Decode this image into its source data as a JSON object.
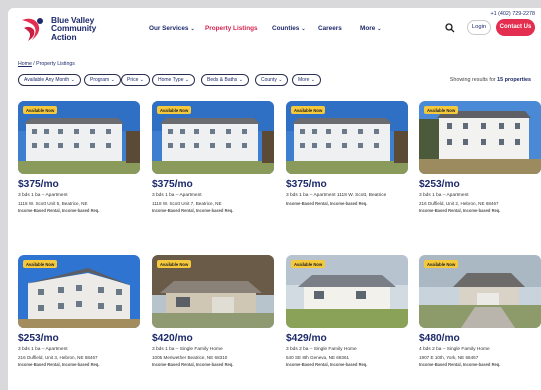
{
  "header": {
    "logo_lines": [
      "Blue Valley",
      "Community",
      "Action"
    ],
    "nav": [
      "Our Services",
      "Property Listings",
      "Counties",
      "Careers",
      "More"
    ],
    "phone": "+1 (402) 729-2278",
    "login": "Login",
    "contact": "Contact Us",
    "colors": {
      "brand_red": "#e42e4f",
      "brand_navy": "#1d2a6b"
    }
  },
  "breadcrumb": {
    "home": "Home",
    "separator": " / ",
    "current": "Property Listings"
  },
  "filters": [
    "Available Any Month",
    "Program",
    "Price",
    "Home Type",
    "Beds & Baths",
    "County",
    "More"
  ],
  "results": {
    "prefix": "Showing results for ",
    "count": "15 properties"
  },
  "listings": [
    {
      "badge": "Available Now",
      "price": "$375/mo",
      "details": "3 bds 1 ba – Apartment",
      "address": "1118 W. Scott Unit 5, Beatrice, NE",
      "tags": "Income-Based Rental, Income-based Req."
    },
    {
      "badge": "Available Now",
      "price": "$375/mo",
      "details": "3 bds 1 ba – Apartment",
      "address": "1118 W. Scott Unit 7, Beatrice, NE",
      "tags": "Income-Based Rental, Income-based Req."
    },
    {
      "badge": "Available Now",
      "price": "$375/mo",
      "details": "3 bds 1 ba – Apartment 1118 W. Scott, Beatrice",
      "address": "",
      "tags": "Income-Based Rental, Income-based Req."
    },
    {
      "badge": "Available Now",
      "price": "$253/mo",
      "details": "3 bds 1 ba – Apartment",
      "address": "216 Duffield, Unit 2, Hebron, NE 68467",
      "tags": "Income-Based Rental, Income-based Req."
    },
    {
      "badge": "Available Now",
      "price": "$253/mo",
      "details": "3 bds 1 ba – Apartment",
      "address": "216 Duffield, Unit 3, Hebron, NE 68467",
      "tags": "Income-Based Rental, Income-based Req."
    },
    {
      "badge": "Available Now",
      "price": "$420/mo",
      "details": "3 bds 1 ba – Single Family Home",
      "address": "1005 Meriwether Beatrice, NE 68310",
      "tags": "Income-Based Rental, Income-based Req."
    },
    {
      "badge": "Available Now",
      "price": "$429/mo",
      "details": "3 bds 2 ba – Single Family Home",
      "address": "540 SE 8th Geneva, NE 68361",
      "tags": "Income-Based Rental, Income-based Req."
    },
    {
      "badge": "Available Now",
      "price": "$480/mo",
      "details": "4 bds 2 ba – Single Family Home",
      "address": "1907 E 10th, York, NE 68467",
      "tags": "Income-Based Rental, Income-based Req."
    }
  ]
}
